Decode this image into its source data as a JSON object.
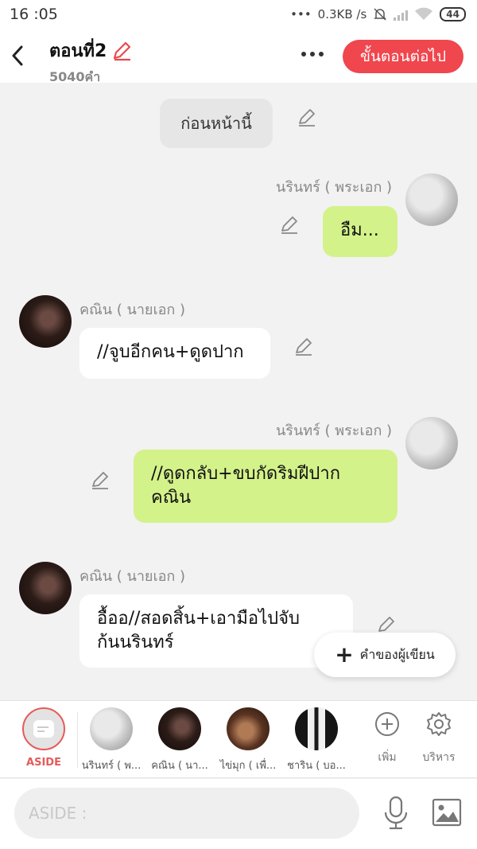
{
  "status_bar": {
    "time": "16 :05",
    "network_speed": "0.3KB /s",
    "battery": "44"
  },
  "header": {
    "title": "ตอนที่2",
    "word_count": "5040คำ",
    "next_button": "ขั้นตอนต่อไป"
  },
  "chat": {
    "previous_button": "ก่อนหน้านี้",
    "messages": [
      {
        "speaker": "นรินทร์ ( พระเอก )",
        "text": "อืม..."
      },
      {
        "speaker": "คณิน ( นายเอก )",
        "text": "//จูบอีกคน+ดูดปาก"
      },
      {
        "speaker": "นรินทร์ ( พระเอก )",
        "text": "//ดูดกลับ+ขบกัดริมฝีปาก\nคณิน"
      },
      {
        "speaker": "คณิน ( นายเอก )",
        "text": "อื้ออ//สอดสิ้น+เอามือไปจับ\nก้นนรินทร์"
      }
    ],
    "author_word_button": "คำของผู้เขียน"
  },
  "character_bar": {
    "aside_label": "ASIDE",
    "characters": [
      {
        "label": "นรินทร์ ( พ..."
      },
      {
        "label": "คณิน ( นา..."
      },
      {
        "label": "ไข่มุก ( เพื่..."
      },
      {
        "label": "ชาริน ( บอ..."
      }
    ],
    "add_label": "เพิ่ม",
    "manage_label": "บริหาร"
  },
  "input": {
    "placeholder": "ASIDE :"
  }
}
